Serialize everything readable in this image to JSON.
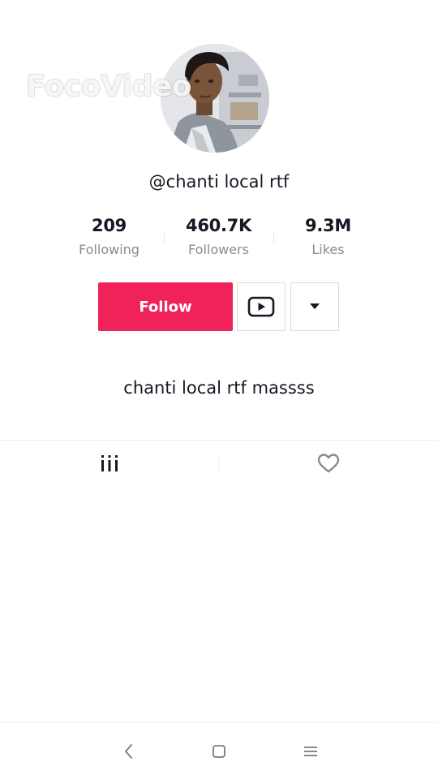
{
  "watermark": {
    "text": "FocoVideo"
  },
  "profile": {
    "username": "@chanti local rtf",
    "bio": "chanti local rtf massss"
  },
  "stats": [
    {
      "value": "209",
      "label": "Following"
    },
    {
      "value": "460.7K",
      "label": "Followers"
    },
    {
      "value": "9.3M",
      "label": "Likes"
    }
  ],
  "actions": {
    "follow_label": "Follow",
    "youtube_icon": "youtube-icon",
    "more_icon": "dropdown-triangle-icon"
  },
  "tabs": [
    {
      "icon": "videos-grid-icon",
      "active": true
    },
    {
      "icon": "heart-icon",
      "active": false
    }
  ],
  "navbar": {
    "icons": [
      "back-icon",
      "home-icon",
      "menu-icon"
    ]
  },
  "colors": {
    "accent": "#f1225a",
    "text_primary": "#161823",
    "text_secondary": "#8a8b91",
    "border": "#dadadd"
  }
}
